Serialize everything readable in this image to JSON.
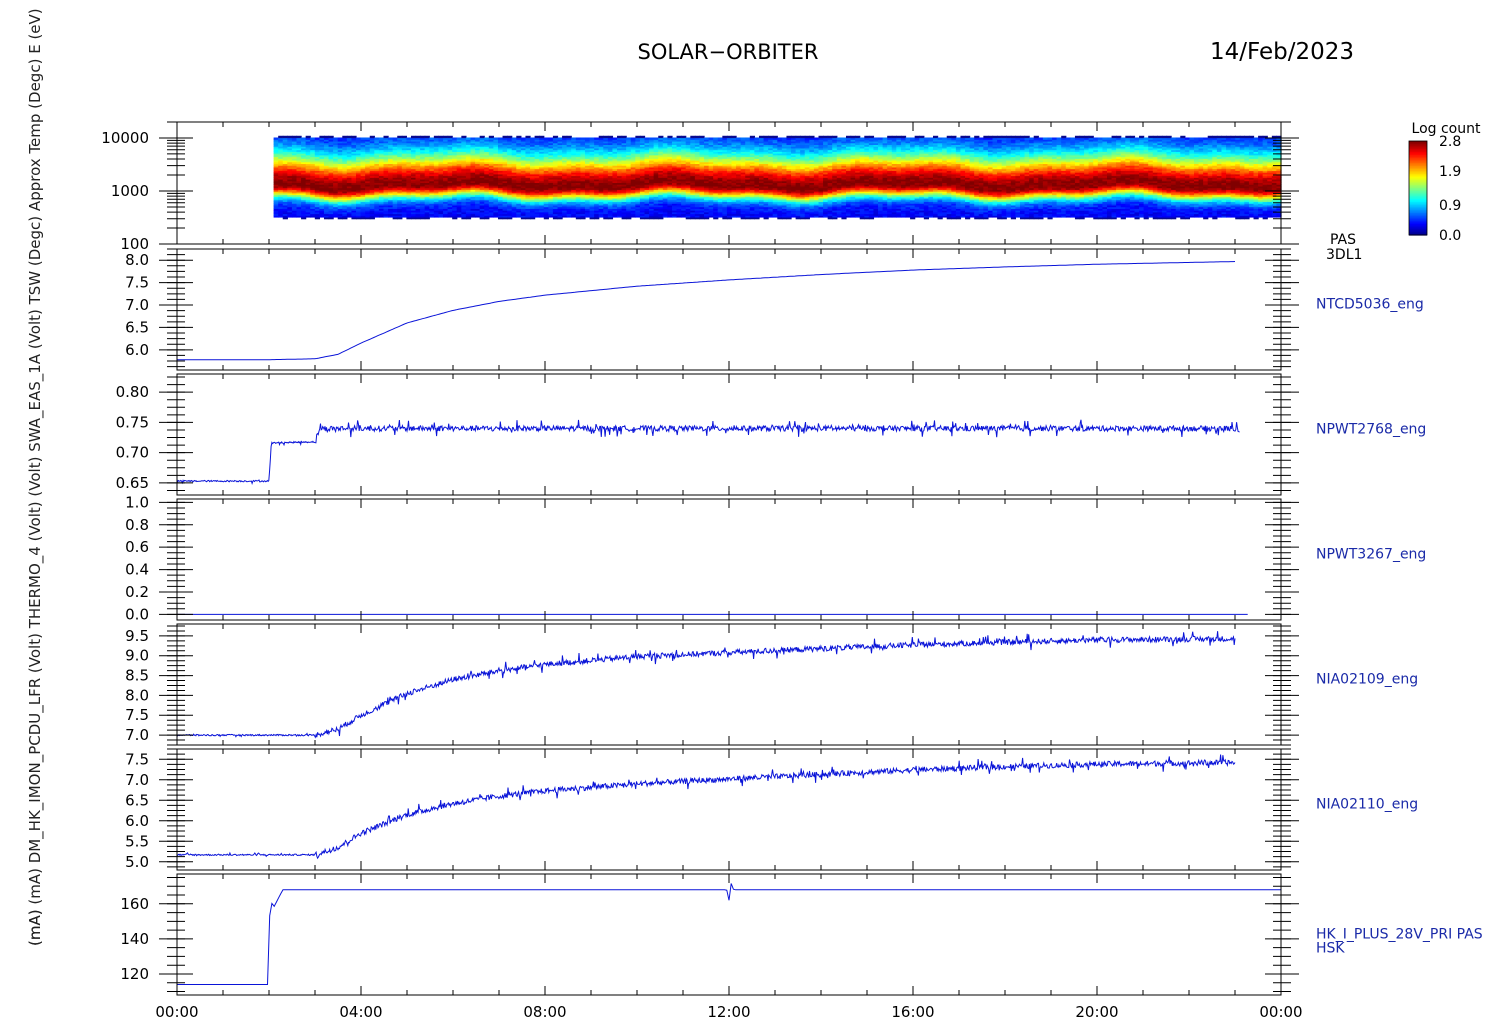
{
  "header": {
    "mission": "SOLAR−ORBITER",
    "date": "14/Feb/2023"
  },
  "x_axis": {
    "ticks": [
      "00:00",
      "04:00",
      "08:00",
      "12:00",
      "16:00",
      "20:00",
      "00:00"
    ],
    "range_hours": [
      0,
      24
    ]
  },
  "side_labels": {
    "ylabels_overlap": "(mA) (mA) DM_HK_IMON_PCDU_LFR (Volt) THERMO_4 (Volt) (Volt) SWA_EAS_1A (Volt) TSW (Degc) Approx Temp (Degc) E (eV)",
    "bottom_mark_1": "(mA)",
    "bottom_mark_2": "(Volt)"
  },
  "colorbar": {
    "title": "Log count",
    "ticks": [
      "2.8",
      "1.9",
      "0.9",
      "0.0"
    ],
    "range": [
      0.0,
      2.8
    ]
  },
  "chart_data": [
    {
      "type": "heatmap",
      "panel": "spectrogram",
      "right_label": "PAS",
      "right_label_2": "3DL1",
      "y_scale": "log",
      "ylim": [
        100,
        20000
      ],
      "yticks": [
        "10000",
        "1000",
        "100"
      ],
      "ytick_values": [
        10000,
        1000,
        100
      ],
      "data_start_hour": 2.1,
      "data_end_hour": 24,
      "band_peak_energy_eV": 1300,
      "band_energy_range_eV": [
        300,
        11000
      ]
    },
    {
      "type": "line",
      "right_label": "NTCD5036_eng",
      "ylim": [
        5.55,
        8.25
      ],
      "yticks": [
        "8.0",
        "7.5",
        "7.0",
        "6.5",
        "6.0"
      ],
      "ytick_values": [
        8.0,
        7.5,
        7.0,
        6.5,
        6.0
      ],
      "x": [
        0,
        2,
        3,
        3.5,
        4,
        5,
        6,
        7,
        8,
        10,
        12,
        14,
        16,
        18,
        20,
        22,
        23
      ],
      "y": [
        5.78,
        5.78,
        5.8,
        5.9,
        6.15,
        6.6,
        6.88,
        7.08,
        7.22,
        7.42,
        7.56,
        7.68,
        7.78,
        7.85,
        7.91,
        7.95,
        7.97
      ]
    },
    {
      "type": "line",
      "right_label": "NPWT2768_eng",
      "ylim": [
        0.63,
        0.83
      ],
      "yticks": [
        "0.80",
        "0.75",
        "0.70",
        "0.65"
      ],
      "ytick_values": [
        0.8,
        0.75,
        0.7,
        0.65
      ],
      "x": [
        0,
        2.0,
        2.05,
        3.0,
        3.1,
        23.0,
        23.1
      ],
      "y": [
        0.653,
        0.653,
        0.716,
        0.718,
        0.74,
        0.74,
        0.735
      ],
      "noise": true
    },
    {
      "type": "line",
      "right_label": "NPWT3267_eng",
      "ylim": [
        -0.05,
        1.03
      ],
      "yticks": [
        "1.0",
        "0.8",
        "0.6",
        "0.4",
        "0.2",
        "0.0"
      ],
      "ytick_values": [
        1.0,
        0.8,
        0.6,
        0.4,
        0.2,
        0.0
      ],
      "x": [
        0,
        23.3,
        23.6,
        23.8
      ],
      "y": [
        0.0,
        0.0,
        null,
        0.0
      ]
    },
    {
      "type": "line",
      "right_label": "NIA02109_eng",
      "ylim": [
        6.75,
        9.8
      ],
      "yticks": [
        "9.5",
        "9.0",
        "8.5",
        "8.0",
        "7.5",
        "7.0"
      ],
      "ytick_values": [
        9.5,
        9.0,
        8.5,
        8.0,
        7.5,
        7.0
      ],
      "x": [
        0,
        3.0,
        3.5,
        4,
        5,
        6,
        7,
        8,
        10,
        12,
        14,
        16,
        18,
        20,
        23
      ],
      "y": [
        7.0,
        7.0,
        7.15,
        7.5,
        8.05,
        8.4,
        8.62,
        8.78,
        8.98,
        9.08,
        9.18,
        9.27,
        9.34,
        9.4,
        9.43
      ],
      "noise": true
    },
    {
      "type": "line",
      "right_label": "NIA02110_eng",
      "ylim": [
        4.8,
        7.75
      ],
      "yticks": [
        "7.5",
        "7.0",
        "6.5",
        "6.0",
        "5.5",
        "5.0"
      ],
      "ytick_values": [
        7.5,
        7.0,
        6.5,
        6.0,
        5.5,
        5.0
      ],
      "x": [
        0,
        3.0,
        3.5,
        4,
        5,
        6,
        7,
        8,
        10,
        12,
        14,
        16,
        18,
        20,
        23
      ],
      "y": [
        5.17,
        5.17,
        5.35,
        5.7,
        6.15,
        6.42,
        6.6,
        6.73,
        6.9,
        7.02,
        7.13,
        7.24,
        7.32,
        7.38,
        7.42
      ],
      "noise": true
    },
    {
      "type": "line",
      "right_label": "HK_I_PLUS_28V_PRI PAS",
      "right_label_2": "HSK",
      "ylim": [
        108,
        177
      ],
      "yticks": [
        "160",
        "140",
        "120"
      ],
      "ytick_values": [
        160,
        140,
        120
      ],
      "x": [
        0,
        2.0,
        2.02,
        2.1,
        2.3,
        2.5,
        11.95,
        12.0,
        12.05,
        12.1,
        12.15,
        24
      ],
      "y": [
        114,
        114,
        163,
        158,
        168,
        168,
        168,
        162,
        172,
        168,
        168,
        168
      ]
    }
  ]
}
